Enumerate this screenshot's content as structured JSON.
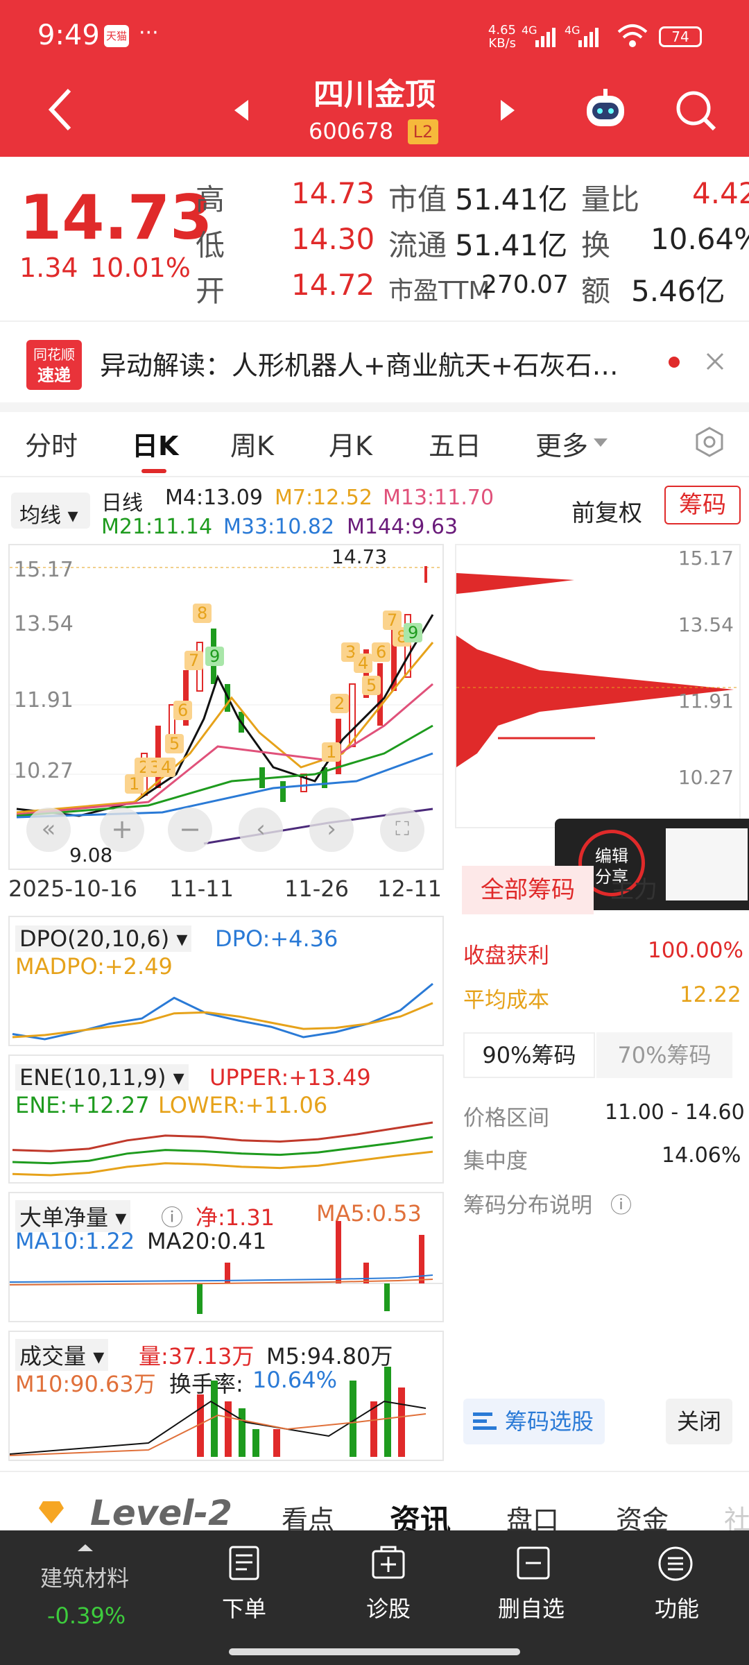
{
  "status": {
    "time": "9:49",
    "app_badge": "天猫",
    "dots": "···",
    "speed_top": "4.65",
    "speed_bottom": "KB/s",
    "net1": "4G",
    "net2": "4G",
    "battery": "74"
  },
  "header": {
    "title": "四川金顶",
    "code": "600678",
    "level_badge": "L2"
  },
  "quote": {
    "price": "14.73",
    "change": "1.34",
    "change_pct": "10.01%",
    "rows": [
      {
        "l1": "高",
        "v1": "14.73",
        "l2": "市值",
        "v2": "51.41亿",
        "l3": "量比",
        "v3": "4.42"
      },
      {
        "l1": "低",
        "v1": "14.30",
        "l2": "流通",
        "v2": "51.41亿",
        "l3": "换",
        "v3": "10.64%"
      },
      {
        "l1": "开",
        "v1": "14.72",
        "l2": "市盈TTM",
        "v2": "270.07",
        "l3": "额",
        "v3": "5.46亿"
      }
    ]
  },
  "news": {
    "logo_top": "同花顺",
    "logo_bottom": "速递",
    "text": "异动解读：人形机器人+商业航天+石灰石…"
  },
  "tabs": [
    "分时",
    "日K",
    "周K",
    "月K",
    "五日",
    "更多"
  ],
  "ma": {
    "selector": "均线",
    "period": "日线",
    "m4": "M4:13.09",
    "m7": "M7:12.52",
    "m13": "M13:11.70",
    "m21": "M21:11.14",
    "m33": "M33:10.82",
    "m144": "M144:9.63",
    "adjust": "前复权",
    "chips_btn": "筹码"
  },
  "kline": {
    "y_labels": [
      "15.17",
      "13.54",
      "11.91",
      "10.27"
    ],
    "high_label": "14.73",
    "low_label": "9.08",
    "dates": [
      "2025-10-16",
      "11-11",
      "11-26",
      "12-11"
    ],
    "markers_a": [
      "1",
      "2",
      "3",
      "4",
      "5",
      "6",
      "7",
      "8",
      "9"
    ],
    "markers_b": [
      "1",
      "2",
      "3",
      "4",
      "5",
      "6",
      "7",
      "8",
      "9"
    ]
  },
  "chips": {
    "y_labels": [
      "15.17",
      "13.54",
      "11.91",
      "10.27"
    ],
    "tab_all": "全部筹码",
    "tab_main": "主力",
    "profit_label": "收盘获利",
    "profit": "100.00%",
    "avg_label": "平均成本",
    "avg": "12.22",
    "tab90": "90%筹码",
    "tab70": "70%筹码",
    "range_label": "价格区间",
    "range": "11.00 - 14.60",
    "conc_label": "集中度",
    "conc": "14.06%",
    "explain": "筹码分布说明",
    "select_btn": "筹码选股",
    "close_btn": "关闭",
    "edit_share": "编辑分享"
  },
  "dpo": {
    "name": "DPO(20,10,6)",
    "dpo": "DPO:+4.36",
    "madpo": "MADPO:+2.49"
  },
  "ene": {
    "name": "ENE(10,11,9)",
    "upper": "UPPER:+13.49",
    "ene": "ENE:+12.27",
    "lower": "LOWER:+11.06"
  },
  "bigorder": {
    "name": "大单净量",
    "net": "净:1.31",
    "ma5": "MA5:0.53",
    "ma10": "MA10:1.22",
    "ma20": "MA20:0.41"
  },
  "volume": {
    "name": "成交量",
    "vol": "量:37.13万",
    "m5": "M5:94.80万",
    "m10": "M10:90.63万",
    "turnover_label": "换手率:",
    "turnover": "10.64%"
  },
  "bottom_tabs": {
    "level2": "Level-2",
    "items": [
      "看点",
      "资讯",
      "盘口",
      "资金",
      "社"
    ]
  },
  "nav": {
    "sector": "建筑材料",
    "sector_chg": "-0.39%",
    "items": [
      "下单",
      "诊股",
      "删自选",
      "功能"
    ]
  },
  "colors": {
    "brand": "#e9333a",
    "up": "#e02a2a",
    "down": "#1e9b1e"
  },
  "chart_data": [
    {
      "type": "line",
      "title": "DPO(20,10,6)",
      "series": [
        {
          "name": "DPO",
          "values": [
            -0.5,
            -1.0,
            -0.3,
            0.5,
            1.0,
            3.0,
            1.5,
            0.8,
            0.2,
            -0.8,
            -0.3,
            0.5,
            1.8,
            4.36
          ]
        },
        {
          "name": "MADPO",
          "values": [
            -0.8,
            -0.6,
            -0.2,
            0.2,
            0.6,
            1.5,
            1.6,
            1.2,
            0.6,
            0.0,
            0.1,
            0.5,
            1.2,
            2.49
          ]
        }
      ]
    },
    {
      "type": "line",
      "title": "ENE(10,11,9)",
      "series": [
        {
          "name": "UPPER",
          "values": [
            11.2,
            11.1,
            11.3,
            12.0,
            12.4,
            12.3,
            12.0,
            11.9,
            12.1,
            12.5,
            13.0,
            13.49
          ]
        },
        {
          "name": "ENE",
          "values": [
            10.2,
            10.1,
            10.3,
            10.9,
            11.2,
            11.1,
            10.9,
            10.8,
            11.0,
            11.4,
            11.8,
            12.27
          ]
        },
        {
          "name": "LOWER",
          "values": [
            9.2,
            9.1,
            9.3,
            9.8,
            10.1,
            10.0,
            9.8,
            9.7,
            9.9,
            10.3,
            10.7,
            11.06
          ]
        }
      ]
    }
  ]
}
